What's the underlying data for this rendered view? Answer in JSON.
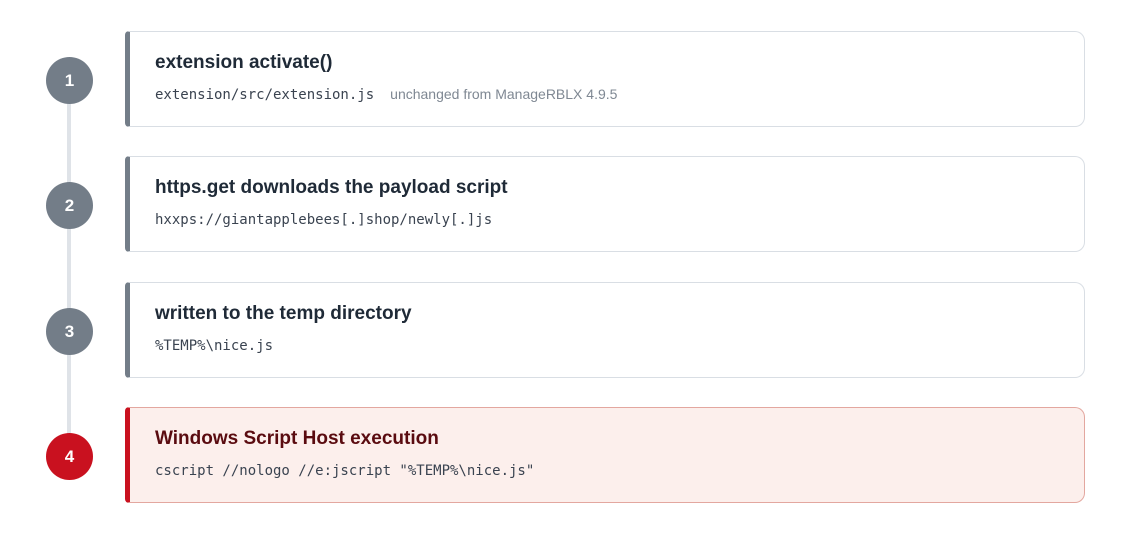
{
  "steps": [
    {
      "number": "1",
      "title": "extension activate()",
      "code": "extension/src/extension.js",
      "note": "unchanged from ManageRBLX 4.9.5"
    },
    {
      "number": "2",
      "title": "https.get downloads the payload script",
      "code": "hxxps://giantapplebees[.]shop/newly[.]js"
    },
    {
      "number": "3",
      "title": "written to the temp directory",
      "code": "%TEMP%\\nice.js"
    },
    {
      "number": "4",
      "title": "Windows Script Host execution",
      "code": "cscript //nologo //e:jscript \"%TEMP%\\nice.js\""
    }
  ],
  "colors": {
    "neutral_accent": "#737d88",
    "alert_accent": "#c9111f",
    "alert_background": "#fcefec"
  }
}
